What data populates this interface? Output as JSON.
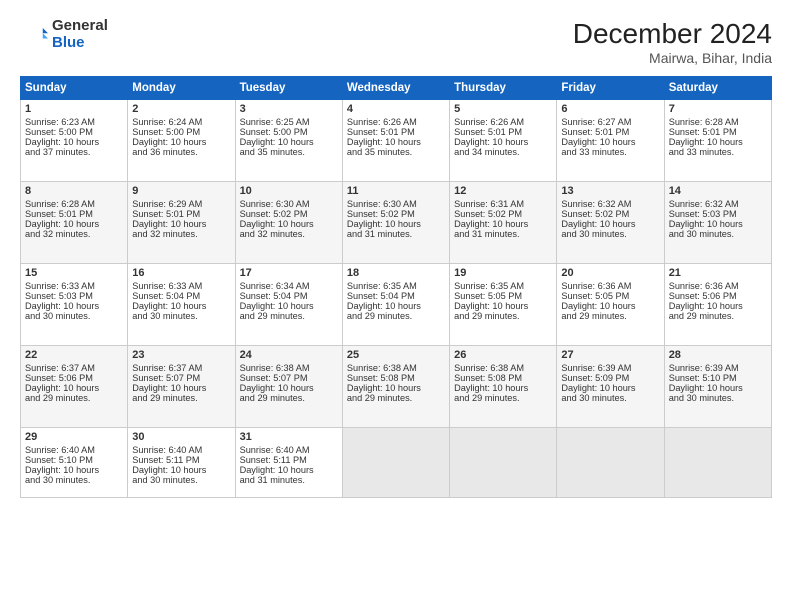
{
  "logo": {
    "general": "General",
    "blue": "Blue"
  },
  "header": {
    "month": "December 2024",
    "location": "Mairwa, Bihar, India"
  },
  "weekdays": [
    "Sunday",
    "Monday",
    "Tuesday",
    "Wednesday",
    "Thursday",
    "Friday",
    "Saturday"
  ],
  "weeks": [
    [
      {
        "day": "1",
        "lines": [
          "Sunrise: 6:23 AM",
          "Sunset: 5:00 PM",
          "Daylight: 10 hours",
          "and 37 minutes."
        ]
      },
      {
        "day": "2",
        "lines": [
          "Sunrise: 6:24 AM",
          "Sunset: 5:00 PM",
          "Daylight: 10 hours",
          "and 36 minutes."
        ]
      },
      {
        "day": "3",
        "lines": [
          "Sunrise: 6:25 AM",
          "Sunset: 5:00 PM",
          "Daylight: 10 hours",
          "and 35 minutes."
        ]
      },
      {
        "day": "4",
        "lines": [
          "Sunrise: 6:26 AM",
          "Sunset: 5:01 PM",
          "Daylight: 10 hours",
          "and 35 minutes."
        ]
      },
      {
        "day": "5",
        "lines": [
          "Sunrise: 6:26 AM",
          "Sunset: 5:01 PM",
          "Daylight: 10 hours",
          "and 34 minutes."
        ]
      },
      {
        "day": "6",
        "lines": [
          "Sunrise: 6:27 AM",
          "Sunset: 5:01 PM",
          "Daylight: 10 hours",
          "and 33 minutes."
        ]
      },
      {
        "day": "7",
        "lines": [
          "Sunrise: 6:28 AM",
          "Sunset: 5:01 PM",
          "Daylight: 10 hours",
          "and 33 minutes."
        ]
      }
    ],
    [
      {
        "day": "8",
        "lines": [
          "Sunrise: 6:28 AM",
          "Sunset: 5:01 PM",
          "Daylight: 10 hours",
          "and 32 minutes."
        ]
      },
      {
        "day": "9",
        "lines": [
          "Sunrise: 6:29 AM",
          "Sunset: 5:01 PM",
          "Daylight: 10 hours",
          "and 32 minutes."
        ]
      },
      {
        "day": "10",
        "lines": [
          "Sunrise: 6:30 AM",
          "Sunset: 5:02 PM",
          "Daylight: 10 hours",
          "and 32 minutes."
        ]
      },
      {
        "day": "11",
        "lines": [
          "Sunrise: 6:30 AM",
          "Sunset: 5:02 PM",
          "Daylight: 10 hours",
          "and 31 minutes."
        ]
      },
      {
        "day": "12",
        "lines": [
          "Sunrise: 6:31 AM",
          "Sunset: 5:02 PM",
          "Daylight: 10 hours",
          "and 31 minutes."
        ]
      },
      {
        "day": "13",
        "lines": [
          "Sunrise: 6:32 AM",
          "Sunset: 5:02 PM",
          "Daylight: 10 hours",
          "and 30 minutes."
        ]
      },
      {
        "day": "14",
        "lines": [
          "Sunrise: 6:32 AM",
          "Sunset: 5:03 PM",
          "Daylight: 10 hours",
          "and 30 minutes."
        ]
      }
    ],
    [
      {
        "day": "15",
        "lines": [
          "Sunrise: 6:33 AM",
          "Sunset: 5:03 PM",
          "Daylight: 10 hours",
          "and 30 minutes."
        ]
      },
      {
        "day": "16",
        "lines": [
          "Sunrise: 6:33 AM",
          "Sunset: 5:04 PM",
          "Daylight: 10 hours",
          "and 30 minutes."
        ]
      },
      {
        "day": "17",
        "lines": [
          "Sunrise: 6:34 AM",
          "Sunset: 5:04 PM",
          "Daylight: 10 hours",
          "and 29 minutes."
        ]
      },
      {
        "day": "18",
        "lines": [
          "Sunrise: 6:35 AM",
          "Sunset: 5:04 PM",
          "Daylight: 10 hours",
          "and 29 minutes."
        ]
      },
      {
        "day": "19",
        "lines": [
          "Sunrise: 6:35 AM",
          "Sunset: 5:05 PM",
          "Daylight: 10 hours",
          "and 29 minutes."
        ]
      },
      {
        "day": "20",
        "lines": [
          "Sunrise: 6:36 AM",
          "Sunset: 5:05 PM",
          "Daylight: 10 hours",
          "and 29 minutes."
        ]
      },
      {
        "day": "21",
        "lines": [
          "Sunrise: 6:36 AM",
          "Sunset: 5:06 PM",
          "Daylight: 10 hours",
          "and 29 minutes."
        ]
      }
    ],
    [
      {
        "day": "22",
        "lines": [
          "Sunrise: 6:37 AM",
          "Sunset: 5:06 PM",
          "Daylight: 10 hours",
          "and 29 minutes."
        ]
      },
      {
        "day": "23",
        "lines": [
          "Sunrise: 6:37 AM",
          "Sunset: 5:07 PM",
          "Daylight: 10 hours",
          "and 29 minutes."
        ]
      },
      {
        "day": "24",
        "lines": [
          "Sunrise: 6:38 AM",
          "Sunset: 5:07 PM",
          "Daylight: 10 hours",
          "and 29 minutes."
        ]
      },
      {
        "day": "25",
        "lines": [
          "Sunrise: 6:38 AM",
          "Sunset: 5:08 PM",
          "Daylight: 10 hours",
          "and 29 minutes."
        ]
      },
      {
        "day": "26",
        "lines": [
          "Sunrise: 6:38 AM",
          "Sunset: 5:08 PM",
          "Daylight: 10 hours",
          "and 29 minutes."
        ]
      },
      {
        "day": "27",
        "lines": [
          "Sunrise: 6:39 AM",
          "Sunset: 5:09 PM",
          "Daylight: 10 hours",
          "and 30 minutes."
        ]
      },
      {
        "day": "28",
        "lines": [
          "Sunrise: 6:39 AM",
          "Sunset: 5:10 PM",
          "Daylight: 10 hours",
          "and 30 minutes."
        ]
      }
    ],
    [
      {
        "day": "29",
        "lines": [
          "Sunrise: 6:40 AM",
          "Sunset: 5:10 PM",
          "Daylight: 10 hours",
          "and 30 minutes."
        ]
      },
      {
        "day": "30",
        "lines": [
          "Sunrise: 6:40 AM",
          "Sunset: 5:11 PM",
          "Daylight: 10 hours",
          "and 30 minutes."
        ]
      },
      {
        "day": "31",
        "lines": [
          "Sunrise: 6:40 AM",
          "Sunset: 5:11 PM",
          "Daylight: 10 hours",
          "and 31 minutes."
        ]
      },
      null,
      null,
      null,
      null
    ]
  ]
}
